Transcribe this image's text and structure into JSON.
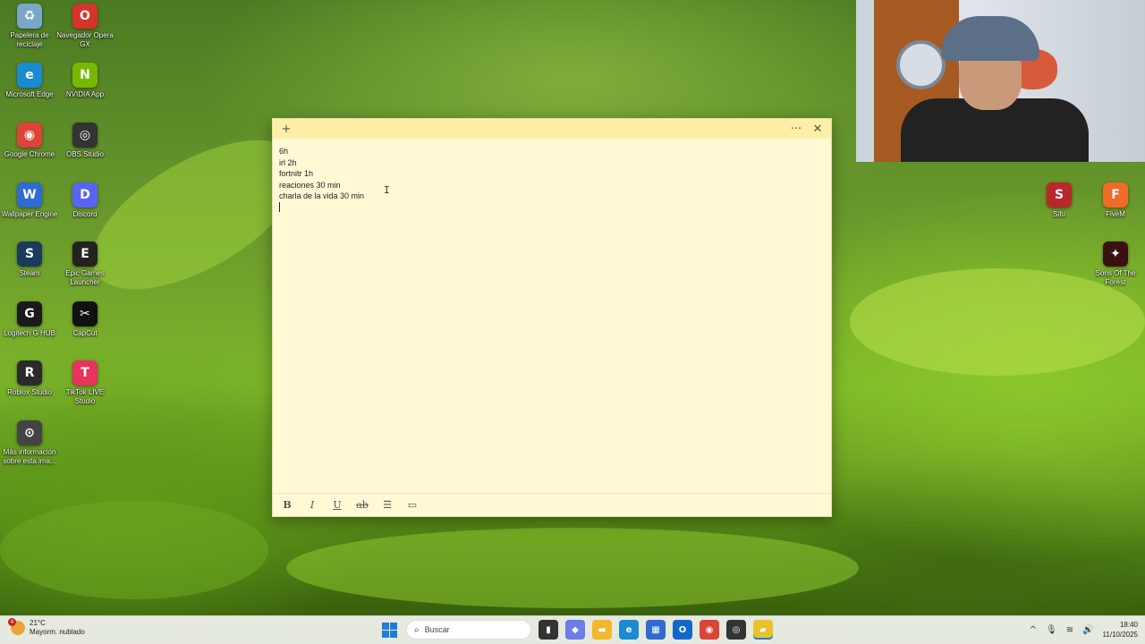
{
  "desktop_icons": [
    {
      "label": "Papelera de reciclaje",
      "icon": "recycle-bin-icon",
      "glyph": "♻",
      "color": "#7aa6c9"
    },
    {
      "label": "Navegador Opera GX",
      "icon": "opera-gx-icon",
      "glyph": "O",
      "color": "#d8332a"
    },
    {
      "label": "Microsoft Edge",
      "icon": "edge-icon",
      "glyph": "e",
      "color": "#1b8ad1"
    },
    {
      "label": "NVIDIA App",
      "icon": "nvidia-icon",
      "glyph": "N",
      "color": "#76b900"
    },
    {
      "label": "Google Chrome",
      "icon": "chrome-icon",
      "glyph": "◉",
      "color": "#db4437"
    },
    {
      "label": "OBS Studio",
      "icon": "obs-icon",
      "glyph": "◎",
      "color": "#333333"
    },
    {
      "label": "Wallpaper Engine",
      "icon": "wallpaper-engine-icon",
      "glyph": "W",
      "color": "#2f6bd0"
    },
    {
      "label": "Discord",
      "icon": "discord-icon",
      "glyph": "D",
      "color": "#5865f2"
    },
    {
      "label": "Steam",
      "icon": "steam-icon",
      "glyph": "S",
      "color": "#1b3a5c"
    },
    {
      "label": "Epic Games Launcher",
      "icon": "epic-games-icon",
      "glyph": "E",
      "color": "#222222"
    },
    {
      "label": "Logitech G HUB",
      "icon": "logitech-icon",
      "glyph": "G",
      "color": "#1a1a1a"
    },
    {
      "label": "CapCut",
      "icon": "capcut-icon",
      "glyph": "✂",
      "color": "#111111"
    },
    {
      "label": "Roblox Studio",
      "icon": "roblox-icon",
      "glyph": "R",
      "color": "#2a2a2a"
    },
    {
      "label": "TikTok LIVE Studio",
      "icon": "tiktok-live-icon",
      "glyph": "T",
      "color": "#e8345c"
    },
    {
      "label": "Más información sobre esta ima...",
      "icon": "info-camera-icon",
      "glyph": "⊙",
      "color": "#444444"
    },
    {
      "label": "Sifu",
      "icon": "sifu-icon",
      "glyph": "S",
      "color": "#b8282a"
    },
    {
      "label": "FiveM",
      "icon": "fivem-icon",
      "glyph": "F",
      "color": "#f06a2a"
    },
    {
      "label": "Sons Of The Forest",
      "icon": "sons-of-the-forest-icon",
      "glyph": "✦",
      "color": "#3a1010"
    }
  ],
  "note": {
    "lines": [
      "6h",
      "irl 2h",
      "fortnitr 1h",
      "reaciones 30 min",
      "charla de la vida 30 min"
    ],
    "header": {
      "add_glyph": "+",
      "menu_glyph": "···",
      "close_glyph": "✕"
    },
    "toolbar": {
      "bold": "B",
      "italic": "I",
      "underline": "U",
      "strike": "ab",
      "list": "☰",
      "image": "▭"
    }
  },
  "taskbar": {
    "weather_temp": "21°C",
    "weather_desc": "Mayorm. nublado",
    "weather_badge": "4",
    "search_placeholder": "Buscar",
    "search_glyph": "⌕",
    "apps": [
      {
        "icon": "task-view-icon",
        "glyph": "▮",
        "color": "#333333"
      },
      {
        "icon": "copilot-icon",
        "glyph": "◆",
        "color": "#6a7de8"
      },
      {
        "icon": "file-explorer-icon",
        "glyph": "▬",
        "color": "#f2b72a"
      },
      {
        "icon": "edge-taskbar-icon",
        "glyph": "e",
        "color": "#1b8ad1"
      },
      {
        "icon": "store-icon",
        "glyph": "▦",
        "color": "#2f6bd0"
      },
      {
        "icon": "outlook-icon",
        "glyph": "O",
        "color": "#1268c6"
      },
      {
        "icon": "chrome-taskbar-icon",
        "glyph": "◉",
        "color": "#db4437"
      },
      {
        "icon": "obs-taskbar-icon",
        "glyph": "◎",
        "color": "#333333"
      },
      {
        "icon": "sticky-notes-icon",
        "glyph": "▰",
        "color": "#e8c32a"
      }
    ],
    "tray": {
      "chevron": "^",
      "mic": "🎙",
      "wifi": "≋",
      "volume": "🔊"
    },
    "time": "18:40",
    "date": "11/10/2025"
  }
}
